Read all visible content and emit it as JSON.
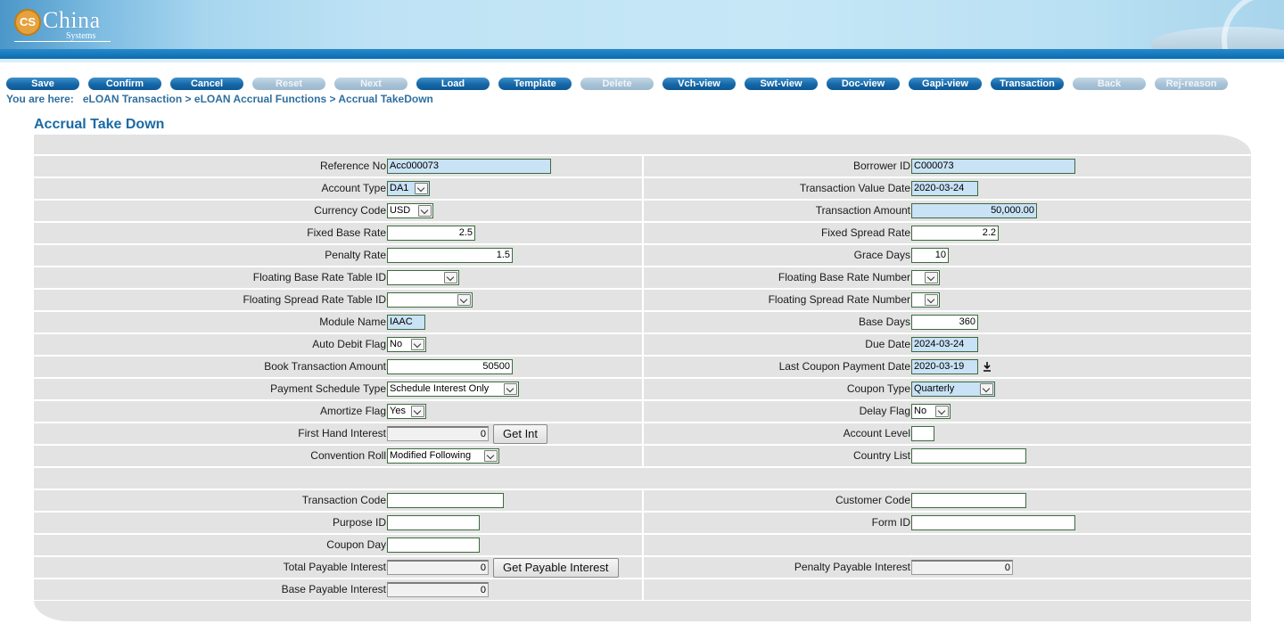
{
  "logo": {
    "badge": "CS",
    "name": "China",
    "sub": "Systems"
  },
  "toolbar": [
    {
      "label": "Save",
      "enabled": true
    },
    {
      "label": "Confirm",
      "enabled": true
    },
    {
      "label": "Cancel",
      "enabled": true
    },
    {
      "label": "Reset",
      "enabled": false
    },
    {
      "label": "Next",
      "enabled": false
    },
    {
      "label": "Load",
      "enabled": true
    },
    {
      "label": "Template",
      "enabled": true
    },
    {
      "label": "Delete",
      "enabled": false
    },
    {
      "label": "Vch-view",
      "enabled": true
    },
    {
      "label": "Swt-view",
      "enabled": true
    },
    {
      "label": "Doc-view",
      "enabled": true
    },
    {
      "label": "Gapi-view",
      "enabled": true
    },
    {
      "label": "Transaction",
      "enabled": true
    },
    {
      "label": "Back",
      "enabled": false
    },
    {
      "label": "Rej-reason",
      "enabled": false
    }
  ],
  "breadcrumb": {
    "prefix": "You are here:",
    "items": [
      "eLOAN Transaction",
      "eLOAN Accrual Functions",
      "Accrual TakeDown"
    ],
    "separator": ">"
  },
  "page_title": "Accrual Take Down",
  "form": {
    "reference_no": {
      "label": "Reference No",
      "value": "Acc000073"
    },
    "borrower_id": {
      "label": "Borrower ID",
      "value": "C000073"
    },
    "account_type": {
      "label": "Account Type",
      "value": "DA1"
    },
    "transaction_value_date": {
      "label": "Transaction Value Date",
      "value": "2020-03-24"
    },
    "currency_code": {
      "label": "Currency Code",
      "value": "USD"
    },
    "transaction_amount": {
      "label": "Transaction Amount",
      "value": "50,000.00"
    },
    "fixed_base_rate": {
      "label": "Fixed Base Rate",
      "value": "2.5"
    },
    "fixed_spread_rate": {
      "label": "Fixed Spread Rate",
      "value": "2.2"
    },
    "penalty_rate": {
      "label": "Penalty Rate",
      "value": "1.5"
    },
    "grace_days": {
      "label": "Grace Days",
      "value": "10"
    },
    "floating_base_rate_table_id": {
      "label": "Floating Base Rate Table ID",
      "value": ""
    },
    "floating_base_rate_number": {
      "label": "Floating Base Rate Number",
      "value": ""
    },
    "floating_spread_rate_table_id": {
      "label": "Floating Spread Rate Table ID",
      "value": ""
    },
    "floating_spread_rate_number": {
      "label": "Floating Spread Rate Number",
      "value": ""
    },
    "module_name": {
      "label": "Module Name",
      "value": "IAAC"
    },
    "base_days": {
      "label": "Base Days",
      "value": "360"
    },
    "auto_debit_flag": {
      "label": "Auto Debit Flag",
      "value": "No"
    },
    "due_date": {
      "label": "Due Date",
      "value": "2024-03-24"
    },
    "book_transaction_amount": {
      "label": "Book Transaction Amount",
      "value": "50500"
    },
    "last_coupon_payment_date": {
      "label": "Last Coupon Payment Date",
      "value": "2020-03-19"
    },
    "payment_schedule_type": {
      "label": "Payment Schedule Type",
      "value": "Schedule Interest Only"
    },
    "coupon_type": {
      "label": "Coupon Type",
      "value": "Quarterly"
    },
    "amortize_flag": {
      "label": "Amortize Flag",
      "value": "Yes"
    },
    "delay_flag": {
      "label": "Delay Flag",
      "value": "No"
    },
    "first_hand_interest": {
      "label": "First Hand Interest",
      "value": "0",
      "button": "Get Int"
    },
    "account_level": {
      "label": "Account Level",
      "value": ""
    },
    "convention_roll": {
      "label": "Convention Roll",
      "value": "Modified Following"
    },
    "country_list": {
      "label": "Country List",
      "value": ""
    },
    "transaction_code": {
      "label": "Transaction Code",
      "value": ""
    },
    "customer_code": {
      "label": "Customer Code",
      "value": ""
    },
    "purpose_id": {
      "label": "Purpose ID",
      "value": ""
    },
    "form_id": {
      "label": "Form ID",
      "value": ""
    },
    "coupon_day": {
      "label": "Coupon Day",
      "value": ""
    },
    "total_payable_interest": {
      "label": "Total Payable Interest",
      "value": "0",
      "button": "Get Payable Interest"
    },
    "penalty_payable_interest": {
      "label": "Penalty Payable Interest",
      "value": "0"
    },
    "base_payable_interest": {
      "label": "Base Payable Interest",
      "value": "0"
    }
  }
}
